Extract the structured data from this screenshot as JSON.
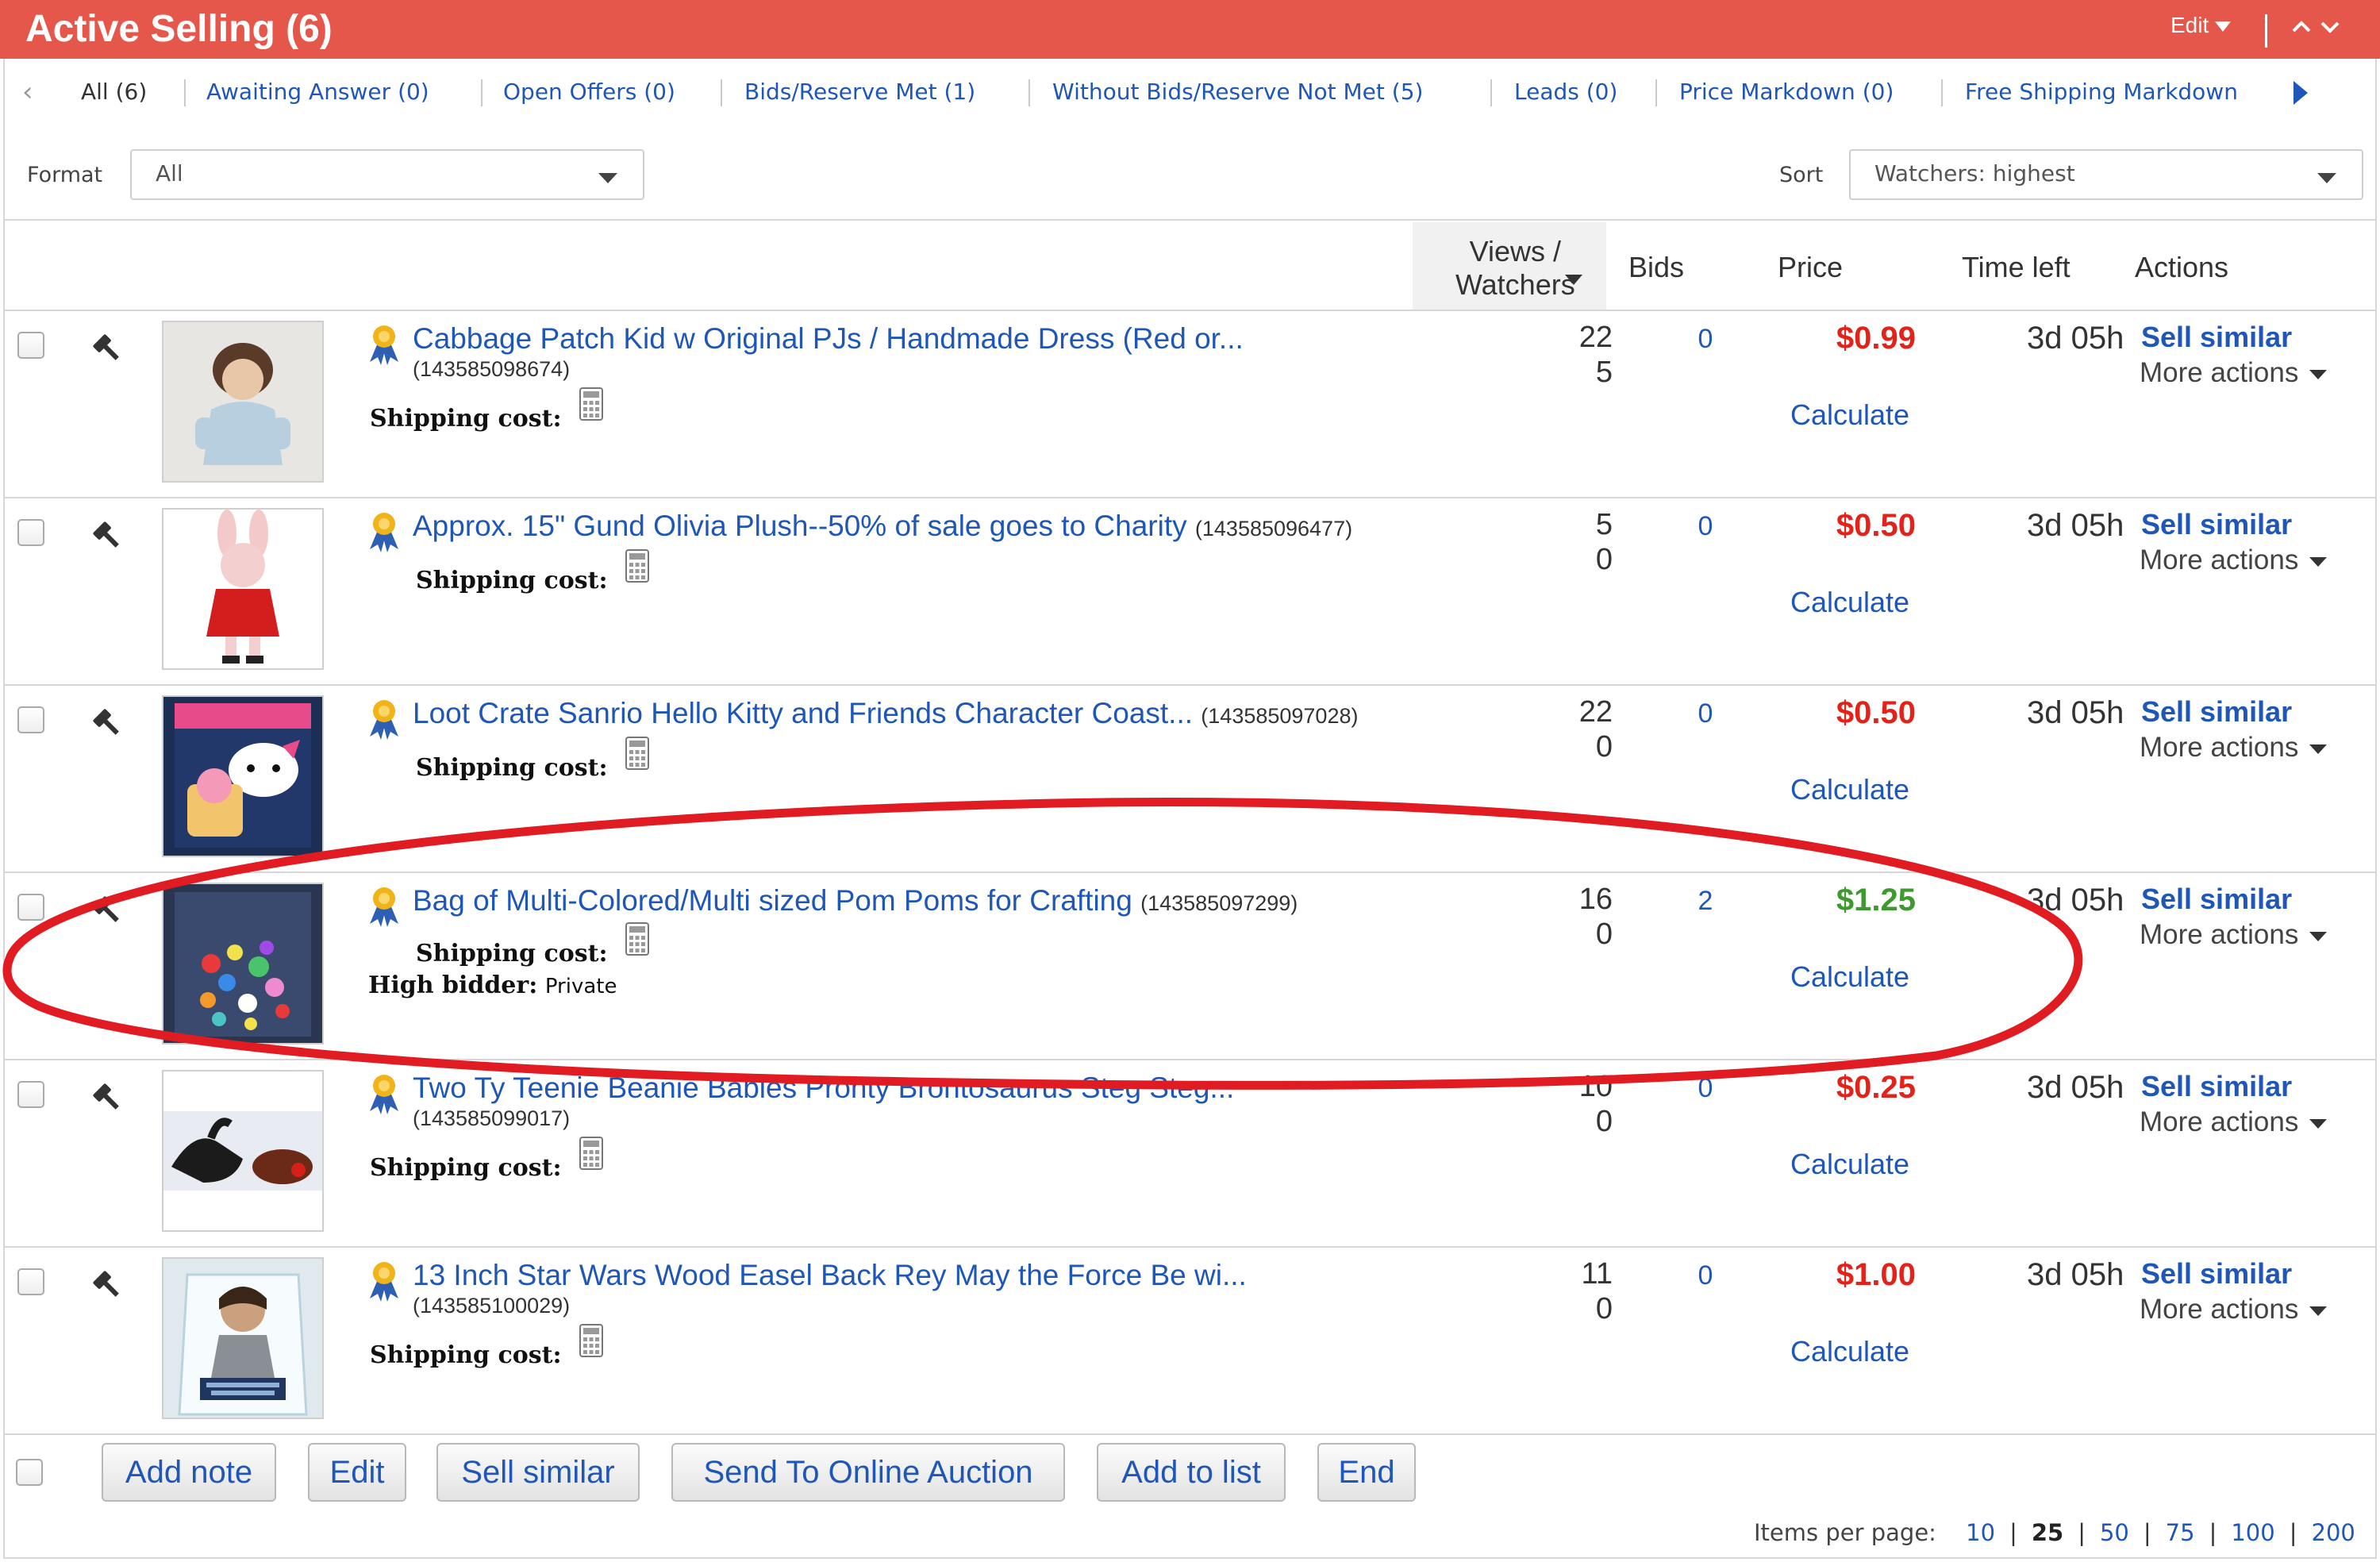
{
  "header": {
    "title": "Active Selling (6)",
    "edit_label": "Edit",
    "brand_color": "#e4574a"
  },
  "filters": [
    {
      "label": "All (6)"
    },
    {
      "label": "Awaiting Answer (0)"
    },
    {
      "label": "Open Offers (0)"
    },
    {
      "label": "Bids/Reserve Met (1)"
    },
    {
      "label": "Without Bids/Reserve Not Met (5)"
    },
    {
      "label": "Leads (0)"
    },
    {
      "label": "Price Markdown (0)"
    },
    {
      "label": "Free Shipping Markdown"
    }
  ],
  "format": {
    "label": "Format",
    "value": "All"
  },
  "sort": {
    "label": "Sort",
    "value": "Watchers: highest"
  },
  "columns": {
    "views_line1": "Views /",
    "views_line2": "Watchers",
    "bids": "Bids",
    "price": "Price",
    "time_left": "Time left",
    "actions": "Actions"
  },
  "labels": {
    "shipping_cost": "Shipping cost:",
    "high_bidder": "High bidder:",
    "calculate": "Calculate",
    "sell_similar": "Sell similar",
    "more_actions": "More actions"
  },
  "items": [
    {
      "title": "Cabbage Patch Kid w Original PJs / Handmade Dress (Red or...",
      "id": "(143585098674)",
      "views": "22",
      "watchers": "5",
      "bids": "0",
      "price": "$0.99",
      "price_color": "#e32219",
      "time_left": "3d 05h"
    },
    {
      "title": "Approx. 15\" Gund Olivia Plush--50% of sale goes to Charity",
      "id": "(143585096477)",
      "views": "5",
      "watchers": "0",
      "bids": "0",
      "price": "$0.50",
      "price_color": "#e32219",
      "time_left": "3d 05h"
    },
    {
      "title": "Loot Crate Sanrio Hello Kitty and Friends Character Coast...",
      "id": "(143585097028)",
      "views": "22",
      "watchers": "0",
      "bids": "0",
      "price": "$0.50",
      "price_color": "#e32219",
      "time_left": "3d 05h"
    },
    {
      "title": "Bag of Multi-Colored/Multi sized Pom Poms for Crafting",
      "id": "(143585097299)",
      "views": "16",
      "watchers": "0",
      "bids": "2",
      "price": "$1.25",
      "price_color": "#3d9a2e",
      "time_left": "3d 05h",
      "high_bidder": "Private"
    },
    {
      "title": "Two Ty Teenie Beanie Babies Pronty Brontosaurus Steg Steg...",
      "id": "(143585099017)",
      "views": "10",
      "watchers": "0",
      "bids": "0",
      "price": "$0.25",
      "price_color": "#e32219",
      "time_left": "3d 05h"
    },
    {
      "title": "13 Inch Star Wars Wood Easel Back Rey May the Force Be wi...",
      "id": "(143585100029)",
      "views": "11",
      "watchers": "0",
      "bids": "0",
      "price": "$1.00",
      "price_color": "#e32219",
      "time_left": "3d 05h"
    }
  ],
  "footer": {
    "buttons": [
      "Add note",
      "Edit",
      "Sell similar",
      "Send To Online Auction",
      "Add to list",
      "End"
    ],
    "items_per_page_label": "Items per page:",
    "page_sizes": [
      "10",
      "25",
      "50",
      "75",
      "100",
      "200"
    ],
    "current_page_size": "25"
  },
  "annotation": {
    "color": "#e11b22",
    "shape": "ellipse",
    "encircles": "Bag of Multi-Colored/Multi sized Pom Poms for Crafting"
  },
  "icons": [
    "chevron-left-icon",
    "chevron-right-icon",
    "caret-down-icon",
    "gavel-icon",
    "ribbon-badge-icon",
    "calculator-icon",
    "chevron-up-icon",
    "chevron-down-icon"
  ]
}
